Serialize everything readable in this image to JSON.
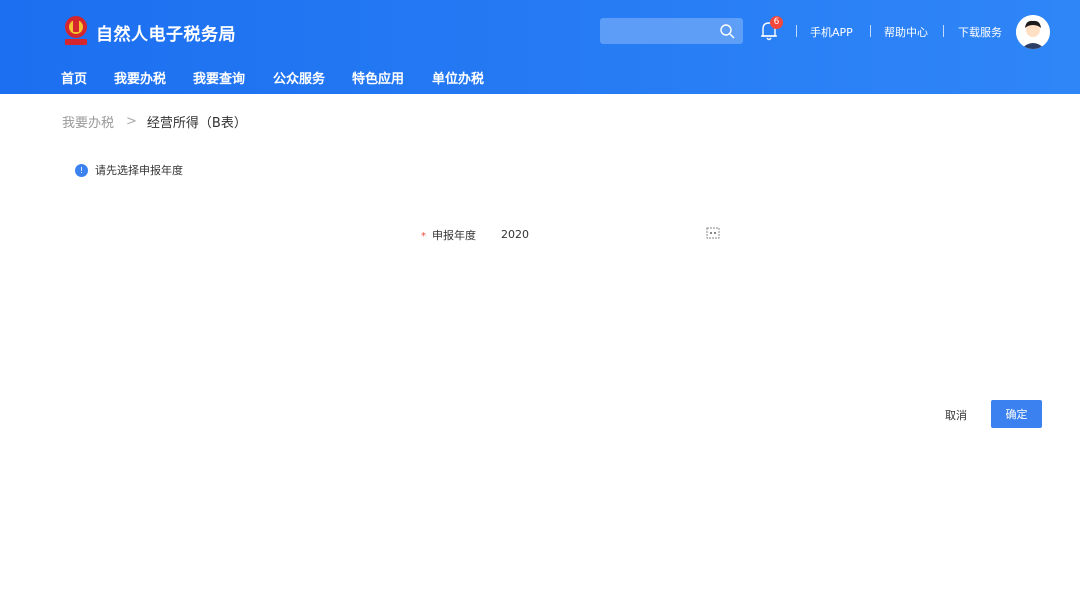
{
  "header": {
    "site_title": "自然人电子税务局",
    "search_placeholder": "",
    "notification_count": "6",
    "links": [
      "手机APP",
      "帮助中心",
      "下载服务"
    ]
  },
  "nav": [
    "首页",
    "我要办税",
    "我要查询",
    "公众服务",
    "特色应用",
    "单位办税"
  ],
  "breadcrumb": {
    "parent": "我要办税",
    "separator": ">",
    "current": "经营所得（B表）"
  },
  "notice": {
    "icon_text": "!",
    "text": "请先选择申报年度"
  },
  "form": {
    "required_mark": "*",
    "year_label": "申报年度",
    "year_value": "2020"
  },
  "actions": {
    "cancel": "取消",
    "confirm": "确定"
  },
  "colors": {
    "header_start": "#1c6ff0",
    "header_end": "#2f86f7",
    "primary": "#3b82f0",
    "badge": "#f5483b"
  }
}
